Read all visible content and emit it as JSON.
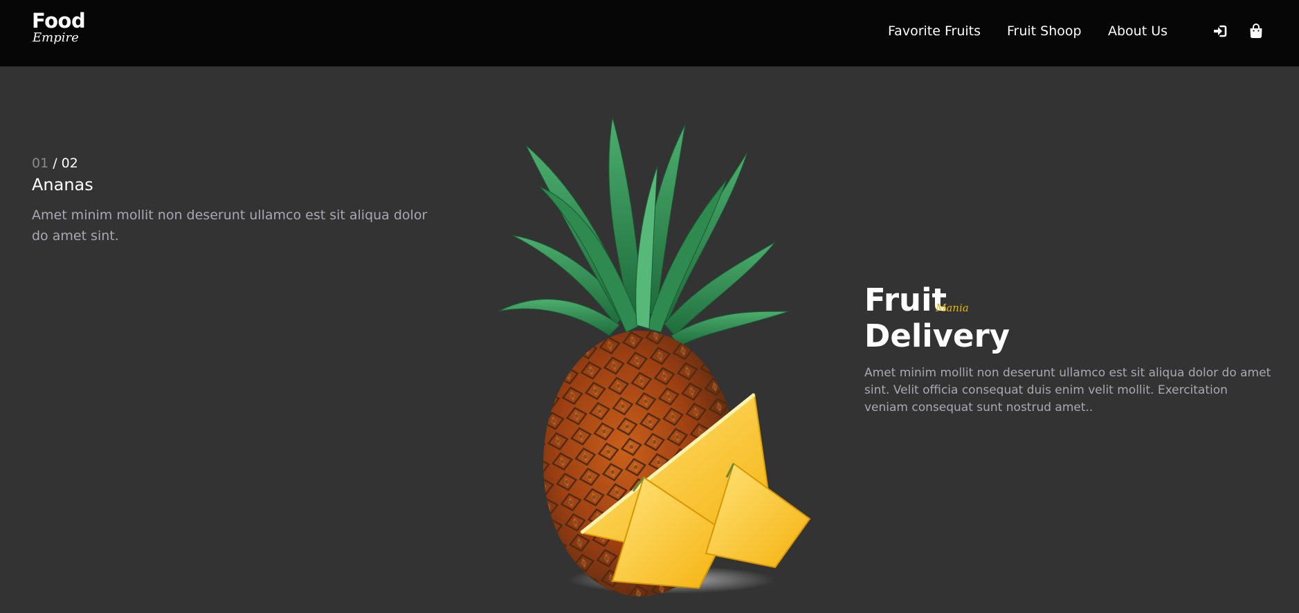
{
  "header": {
    "logo_main": "Food",
    "logo_script": "Empire",
    "nav": [
      "Favorite Fruits",
      "Fruit Shoop",
      "About Us"
    ],
    "icons": [
      "sign-in-icon",
      "shopping-bag-icon"
    ]
  },
  "slider": {
    "current": "01",
    "separator": " / ",
    "total": "02",
    "title": "Ananas",
    "description": "Amet minim mollit non deserunt ullamco est sit aliqua dolor do amet sint."
  },
  "hero": {
    "title_line1": "Fruit",
    "badge": "Mania",
    "title_line2": "Delivery",
    "description": "Amet minim mollit non deserunt ullamco est sit aliqua dolor do amet sint. Velit officia consequat duis enim velit mollit. Exercitation veniam consequat sunt nostrud amet.."
  },
  "colors": {
    "page_bg": "#333333",
    "header_bg": "#060606",
    "text_muted": "#a9a9b3",
    "counter_muted": "#8b8b8b",
    "accent": "#e6b800"
  }
}
